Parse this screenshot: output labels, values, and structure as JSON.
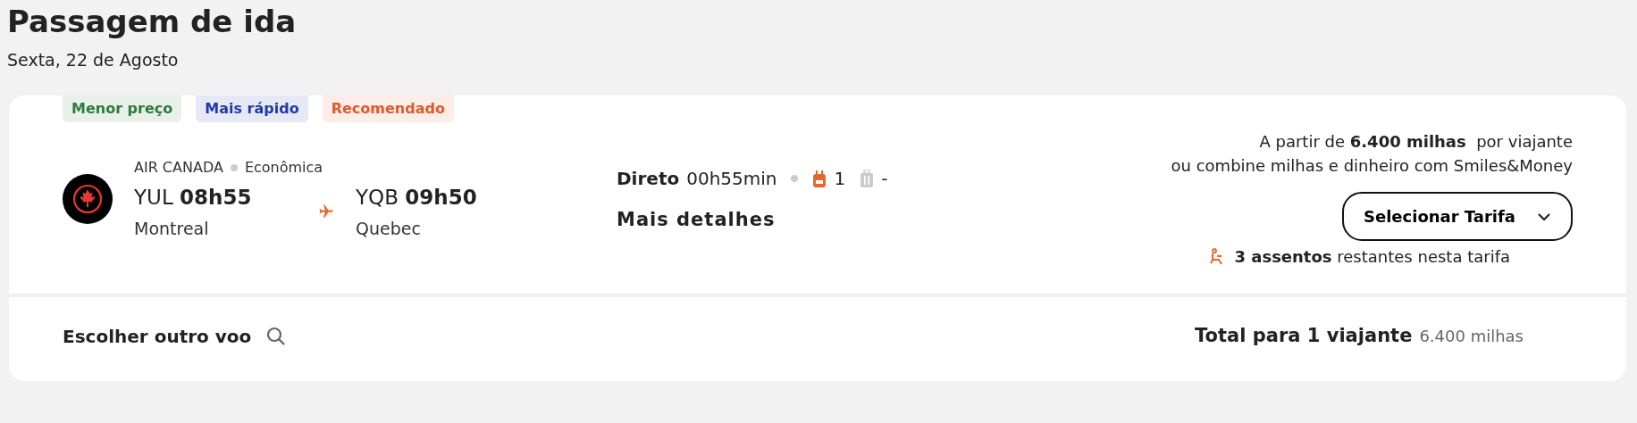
{
  "header": {
    "title": "Passagem de ida",
    "date": "Sexta, 22 de Agosto"
  },
  "tags": [
    {
      "label": "Menor preço",
      "color": "#2f7a3a"
    },
    {
      "label": "Mais rápido",
      "color": "#1f3aa8"
    },
    {
      "label": "Recomendado",
      "color": "#e0592a"
    }
  ],
  "flight": {
    "airline": "AIR CANADA",
    "cabin": "Econômica",
    "origin": {
      "code": "YUL",
      "time": "08h55",
      "city": "Montreal"
    },
    "destination": {
      "code": "YQB",
      "time": "09h50",
      "city": "Quebec"
    },
    "stops": "Direto",
    "duration": "00h55min",
    "carry_on": "1",
    "checked_bag": "-",
    "details_link": "Mais detalhes"
  },
  "price": {
    "from": "A partir de **6.400 milhas**  por viajante",
    "combine": "ou combine milhas e dinheiro com Smiles&Money",
    "button": "Selecionar Tarifa",
    "seats": "**3 assentos** restantes nesta tarifa"
  },
  "footer": {
    "other_flight": "Escolher outro voo",
    "total_label": "Total para 1 viajante",
    "total_value": "6.400 milhas"
  }
}
